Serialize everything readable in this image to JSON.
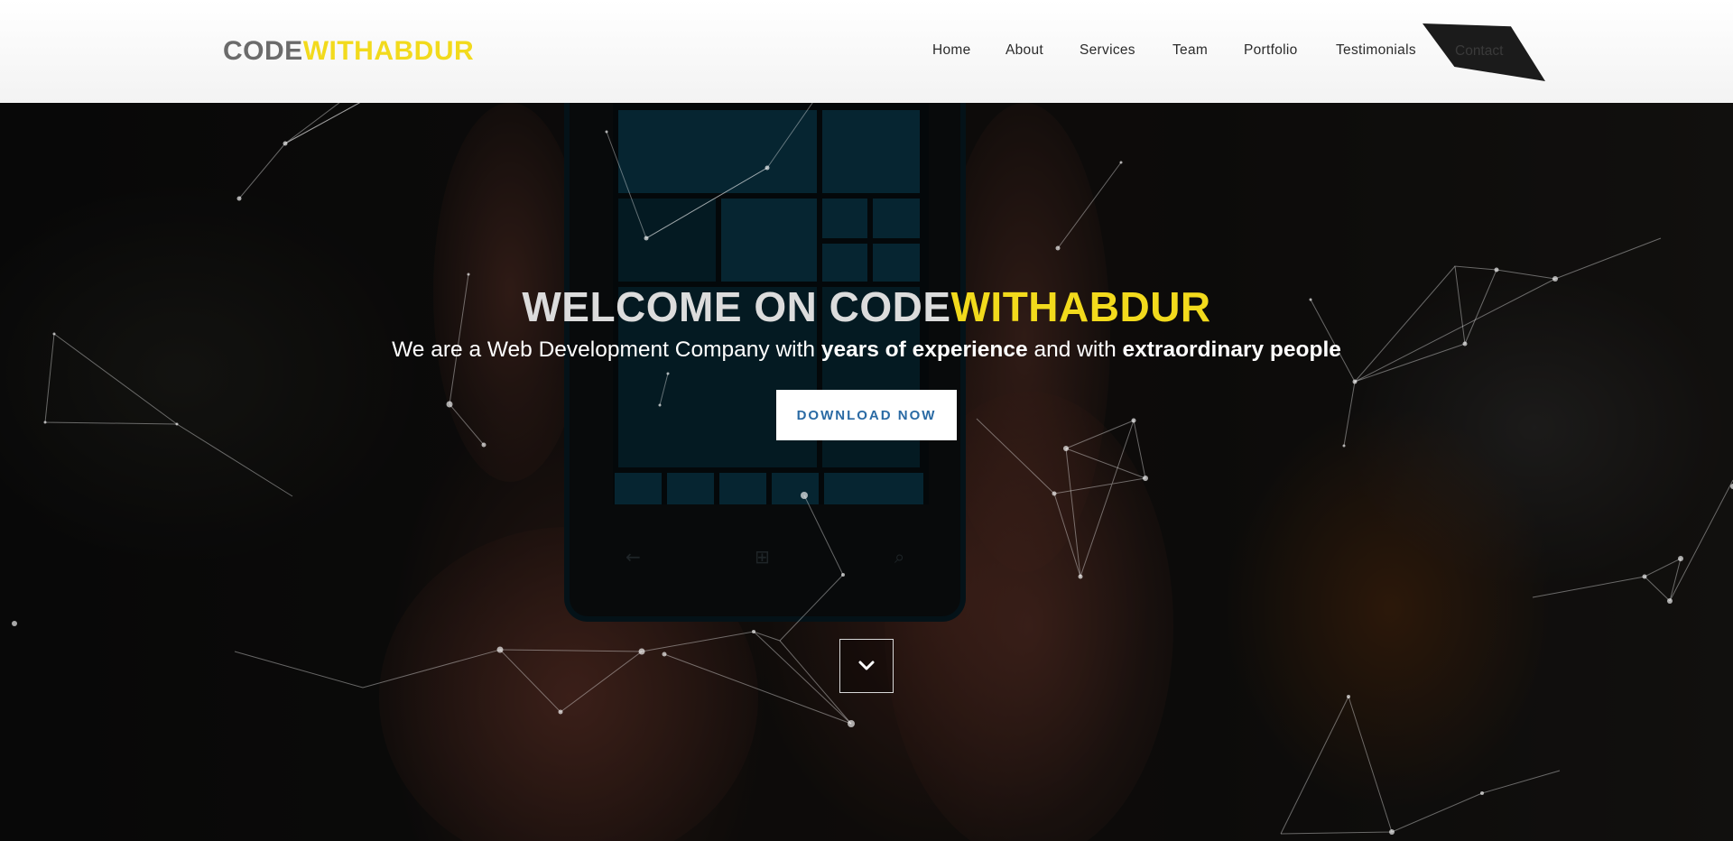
{
  "brand": {
    "part_a": "CODE",
    "part_b": "WITHABDUR"
  },
  "nav": {
    "items": [
      {
        "label": "Home"
      },
      {
        "label": "About"
      },
      {
        "label": "Services"
      },
      {
        "label": "Team"
      },
      {
        "label": "Portfolio"
      },
      {
        "label": "Testimonials"
      }
    ],
    "contact_label": "Contact"
  },
  "hero": {
    "title_prefix": "WELCOME ON ",
    "title_brand_a": "CODE",
    "title_brand_b": "WITHABDUR",
    "subtitle_1": "We are a Web Development Company with ",
    "subtitle_bold_1": "years of experience",
    "subtitle_2": " and with ",
    "subtitle_bold_2": "extraordinary people",
    "download_label": "DOWNLOAD NOW",
    "scroll_icon": "chevron-down-icon"
  },
  "colors": {
    "brand_yellow": "#f2da1c",
    "brand_gray": "#6b6b6b",
    "button_text": "#2a6aa4",
    "contact_bg": "#1b1b1b"
  }
}
